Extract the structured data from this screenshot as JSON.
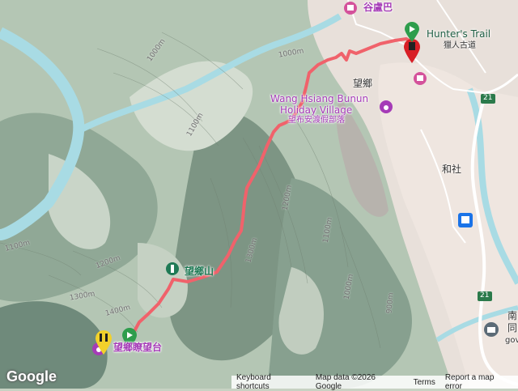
{
  "labels": {
    "gulubu": "谷盧巴",
    "hunters_trail_en": "Hunter's Trail",
    "hunters_trail_zh": "獵人古道",
    "wangxiang": "望鄉",
    "wang_hsiang_bunun_1": "Wang Hsiang Bunun",
    "wang_hsiang_bunun_2": "Holiday Village",
    "wang_hsiang_bunun_zh": "望布安渡假部落",
    "heshe": "和社",
    "wangxiang_mtn": "望鄉山",
    "wangliao_platform": "望鄉瞭望台",
    "nan": "南",
    "tong": "同",
    "gov": "gov"
  },
  "contours": [
    "1000m",
    "1000m",
    "1100m",
    "1200m",
    "1300m",
    "1100m",
    "1100m",
    "1200m",
    "1300m",
    "1400m",
    "1000m",
    "900m"
  ],
  "road_shield": [
    "21",
    "21"
  ],
  "footer": {
    "shortcuts": "Keyboard shortcuts",
    "map_data": "Map data ©2026 Google",
    "terms": "Terms",
    "report": "Report a map error"
  },
  "brand": "Google",
  "colors": {
    "track": "#f0626b",
    "water": "#a8dbe4",
    "forest": "#7f9a8a",
    "urban": "#ece2dc",
    "green_marker": "#2e9d4c",
    "red_marker": "#d81f26"
  }
}
